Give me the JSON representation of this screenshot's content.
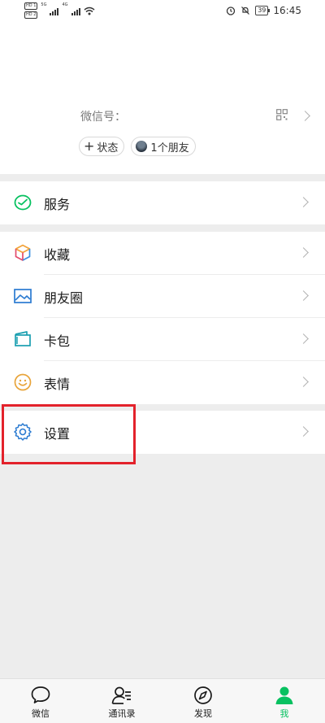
{
  "status_bar": {
    "sim1": "HD 1",
    "sim2": "HD 2",
    "net1": "5G",
    "net2": "4G",
    "battery": "39",
    "time": "16:45",
    "icons": [
      "alarm-icon",
      "mute-icon",
      "wifi-icon",
      "battery-icon"
    ]
  },
  "profile": {
    "wechat_id_label": "微信号：",
    "status_chip": "状态",
    "friends_chip": "1个朋友"
  },
  "menu": {
    "services": "服务",
    "favorites": "收藏",
    "moments": "朋友圈",
    "cards": "卡包",
    "stickers": "表情",
    "settings": "设置"
  },
  "tabs": [
    {
      "label": "微信",
      "icon": "chat-icon"
    },
    {
      "label": "通讯录",
      "icon": "contacts-icon"
    },
    {
      "label": "发现",
      "icon": "compass-icon"
    },
    {
      "label": "我",
      "icon": "person-icon",
      "active": true
    }
  ],
  "colors": {
    "accent": "#07c160",
    "highlight": "#e3222b",
    "background": "#ededed"
  }
}
